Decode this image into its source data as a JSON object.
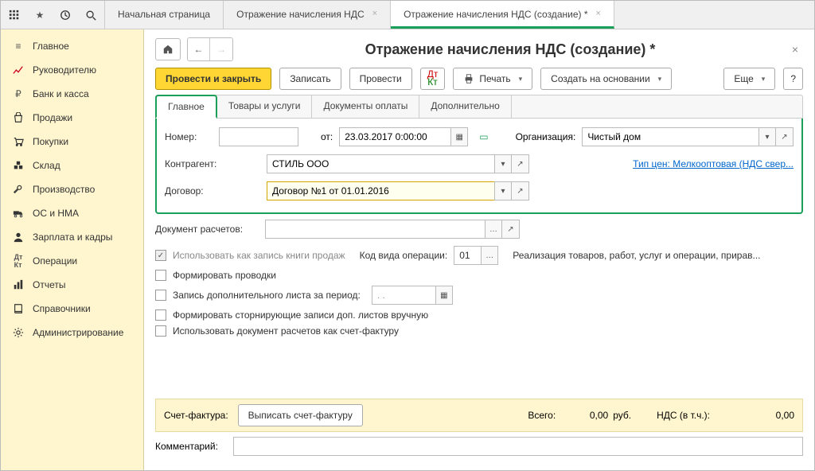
{
  "topbar": {
    "tabs": [
      {
        "label": "Начальная страница",
        "closable": false
      },
      {
        "label": "Отражение начисления НДС",
        "closable": true
      },
      {
        "label": "Отражение начисления НДС (создание) *",
        "closable": true,
        "active": true
      }
    ]
  },
  "sidebar": {
    "items": [
      {
        "label": "Главное",
        "icon": "menu"
      },
      {
        "label": "Руководителю",
        "icon": "chart"
      },
      {
        "label": "Банк и касса",
        "icon": "ruble"
      },
      {
        "label": "Продажи",
        "icon": "bag"
      },
      {
        "label": "Покупки",
        "icon": "cart"
      },
      {
        "label": "Склад",
        "icon": "boxes"
      },
      {
        "label": "Производство",
        "icon": "wrench"
      },
      {
        "label": "ОС и НМА",
        "icon": "truck"
      },
      {
        "label": "Зарплата и кадры",
        "icon": "person"
      },
      {
        "label": "Операции",
        "icon": "dtk"
      },
      {
        "label": "Отчеты",
        "icon": "bars"
      },
      {
        "label": "Справочники",
        "icon": "book"
      },
      {
        "label": "Администрирование",
        "icon": "gear"
      }
    ]
  },
  "page": {
    "title": "Отражение начисления НДС (создание) *"
  },
  "cmd": {
    "post_close": "Провести и закрыть",
    "save": "Записать",
    "post": "Провести",
    "print": "Печать",
    "create_based": "Создать на основании",
    "more": "Еще"
  },
  "inner_tabs": [
    "Главное",
    "Товары и услуги",
    "Документы оплаты",
    "Дополнительно"
  ],
  "form": {
    "number_label": "Номер:",
    "number_value": "",
    "date_label": "от:",
    "date_value": "23.03.2017 0:00:00",
    "org_label": "Организация:",
    "org_value": "Чистый дом",
    "counterparty_label": "Контрагент:",
    "counterparty_value": "СТИЛЬ ООО",
    "price_type_link": "Тип цен: Мелкооптовая (НДС свер...",
    "contract_label": "Договор:",
    "contract_value": "Договор №1 от 01.01.2016",
    "settlement_doc_label": "Документ расчетов:",
    "settlement_doc_value": "",
    "use_sales_book_label": "Использовать как запись книги продаж",
    "op_code_label": "Код вида операции:",
    "op_code_value": "01",
    "op_code_desc": "Реализация товаров, работ, услуг и операции, прирав...",
    "chk_postings": "Формировать проводки",
    "chk_addsheet": "Запись дополнительного листа за период:",
    "addsheet_period": "  .  .",
    "chk_storno": "Формировать сторнирующие записи доп. листов вручную",
    "chk_invoice_doc": "Использовать документ расчетов как счет-фактуру"
  },
  "footer": {
    "invoice_label": "Счет-фактура:",
    "invoice_btn": "Выписать счет-фактуру",
    "total_label": "Всего:",
    "total_value": "0,00",
    "currency": "руб.",
    "vat_label": "НДС (в т.ч.):",
    "vat_value": "0,00",
    "comment_label": "Комментарий:",
    "comment_value": ""
  }
}
